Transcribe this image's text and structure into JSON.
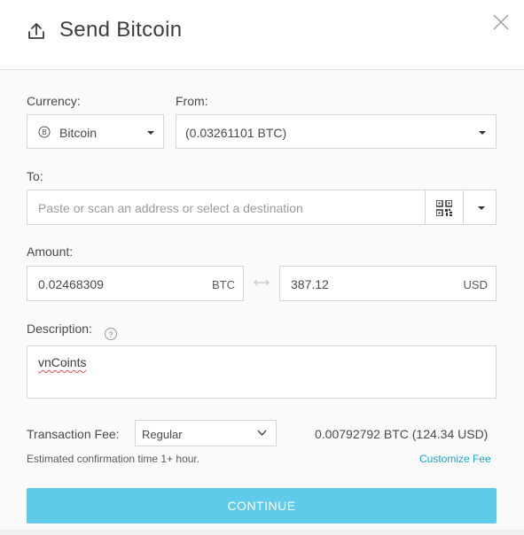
{
  "header": {
    "title": "Send Bitcoin",
    "icon": "upload-icon"
  },
  "currency": {
    "label": "Currency:",
    "value": "Bitcoin",
    "icon": "bitcoin-icon"
  },
  "from": {
    "label": "From:",
    "value": "(0.03261101 BTC)"
  },
  "to": {
    "label": "To:",
    "placeholder": "Paste or scan an address or select a destination",
    "qr_icon": "qr-code-icon"
  },
  "amount": {
    "label": "Amount:",
    "btc_value": "0.02468309",
    "btc_unit": "BTC",
    "usd_value": "387.12",
    "usd_unit": "USD",
    "swap_icon": "swap-arrows-icon"
  },
  "description": {
    "label": "Description:",
    "help": "?",
    "value": "vnCoints"
  },
  "fee": {
    "label": "Transaction Fee:",
    "option": "Regular",
    "amount": "0.00792792 BTC (124.34 USD)",
    "estimate": "Estimated confirmation time 1+ hour.",
    "customize": "Customize Fee"
  },
  "continue": "CONTINUE",
  "colors": {
    "accent": "#5fcbe8",
    "link": "#1aa6d0"
  }
}
